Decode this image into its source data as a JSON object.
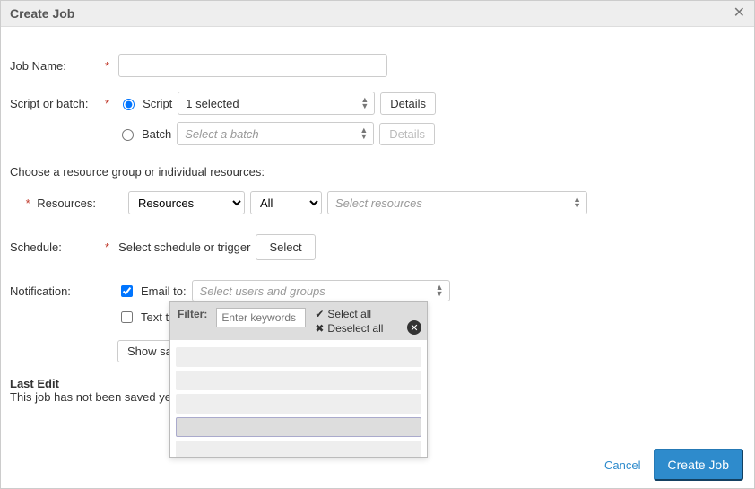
{
  "dialog": {
    "title": "Create Job"
  },
  "jobName": {
    "label": "Job Name:",
    "value": ""
  },
  "scriptOrBatch": {
    "label": "Script or batch:",
    "scriptLabel": "Script",
    "batchLabel": "Batch",
    "scriptSelected": "1 selected",
    "batchPlaceholder": "Select a batch",
    "detailsLabel": "Details"
  },
  "resources": {
    "sectionText": "Choose a resource group or individual resources:",
    "label": "Resources:",
    "typeSelected": "Resources",
    "scopeSelected": "All",
    "multiPlaceholder": "Select resources"
  },
  "schedule": {
    "label": "Schedule:",
    "hint": "Select schedule or trigger",
    "selectBtn": "Select"
  },
  "notification": {
    "label": "Notification:",
    "emailLabel": "Email to:",
    "textLabel": "Text to:",
    "emailPlaceholder": "Select users and groups",
    "showSampleBtn": "Show sample"
  },
  "dropdown": {
    "filterLabel": "Filter:",
    "filterPlaceholder": "Enter keywords",
    "selectAll": "Select all",
    "deselectAll": "Deselect all"
  },
  "lastEdit": {
    "title": "Last Edit",
    "text": "This job has not been saved yet."
  },
  "footer": {
    "cancel": "Cancel",
    "submit": "Create Job"
  }
}
